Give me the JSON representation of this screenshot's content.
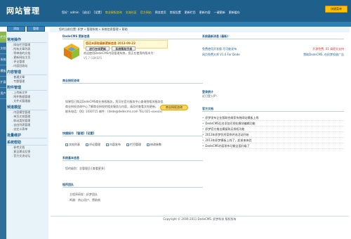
{
  "header": {
    "logo": "网站管理",
    "top_links": [
      "您好：admin",
      "[退出]",
      "[设置]",
      "商业授权咨询",
      "交流社区",
      "官方网站",
      "预览首页",
      "常规设置",
      "更新栏目",
      "更新内容",
      "一键更新",
      "更新缓存"
    ],
    "quit_label": "快捷菜单"
  },
  "add_buttons": [
    "添加",
    "管理"
  ],
  "vtabs": [
    "栏目",
    "文档",
    "系统",
    "模板",
    "扩展",
    "用户"
  ],
  "menu": [
    {
      "head": "常用操作",
      "items": [
        "网站栏目管理",
        "所有文章列表",
        "等审核的文档",
        "更新网站主页",
        "评论管理",
        "内容回收站"
      ]
    },
    {
      "head": "内容管理",
      "items": [
        "普通文章",
        "专题管理"
      ]
    },
    {
      "head": "附件管理",
      "items": [
        "上传新文件",
        "附件数据管理",
        "文件式管理器"
      ]
    },
    {
      "head": "频道模型",
      "items": [
        "内容模型管理",
        "单页文档管理",
        "联动类别管理",
        "自由列表管理",
        "自定义表单"
      ]
    },
    {
      "head": "批量维护",
      "items": []
    },
    {
      "head": "系统帮助",
      "items": [
        "参考文档",
        "意见建议反馈",
        "官方交流论坛"
      ]
    }
  ],
  "breadcrumb": "您的当前位置: 织梦 » 管理系统 » 系统信息管理 » 帮助",
  "main": {
    "news_title": "DedeCMS 更新信息",
    "update_banner": "您还未获取最新更新信息 2013-09-22",
    "update_btn1": "进行在线更新",
    "update_btn2": "系统帮助手册",
    "update_note": "欢迎使用DedeCMS内容管理系统，您正在使用的版本为：",
    "version": "V5.7 GBKSP1",
    "license_title": "商业授权咨询",
    "license_lines": [
      "如果您已购买DedeCMS商业授权服务，您可在官方服务中心查询到相关服务信息，如果您是免费用户，可以通过",
      "商业授权咨询中心了解商业授权的相关服务与内容，请及时查看文档更新。",
      "联系电话：QQ: 1030715 邮件：(dede@dedecms.com TEL:021-xxxxxx)"
    ],
    "license_btn": "商业授权咨询",
    "quick_title": "快捷操作 【管理】【设置】",
    "quick_tabs": [
      "文档列表",
      "评论管理",
      "内容发布",
      "栏目管理",
      "修改参数"
    ],
    "sysinfo_title": "系统基本信息",
    "sysinfo_line": "您的级别：总管理员 [查看更多]",
    "team_title": "程序团队",
    "team_lines": [
      "主程序研发：织梦团队",
      "鸣谢：热心用户、赞助商"
    ]
  },
  "right": {
    "notice_title": "系统最新消息 (最新)",
    "notice_lines": [
      {
        "a": "免费使用开发版 尽可能发布",
        "b": "开源免费, 01 请提交支持"
      },
      {
        "a": "网页免费大师 V1.0 For Dede",
        "b": "赞助DedeCMS, 在织梦投放广告"
      }
    ],
    "login_title": "登录统计",
    "login_sub": "近日登入IP：",
    "news_title": "官方文档",
    "news_items": [
      "织梦发布企业版联合商家系统网站模板上线",
      "DedeCMS后台添加可视化模块编辑功能",
      "织梦官方推出模板购买授权功能",
      "2013年织梦优秀案例评选活动开始",
      "2013年织梦模板上线了，赶紧来体验",
      "DedeCMS内容发布功能全面升级了"
    ]
  },
  "footer": "Copyright © 2004-2011 DedeCMS. 织梦科技 版权所有"
}
